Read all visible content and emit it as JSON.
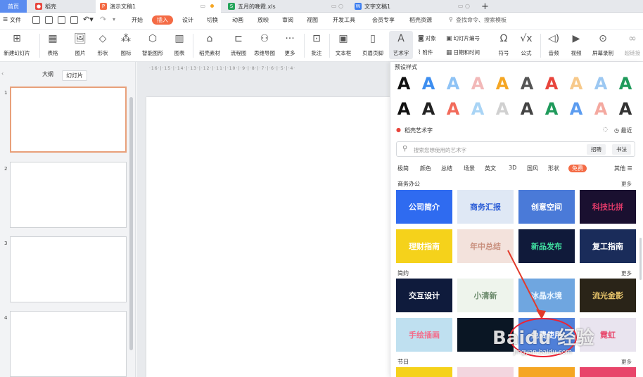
{
  "tabs": [
    {
      "label": "首页",
      "color": "#5b8cf0"
    },
    {
      "label": "稻壳",
      "color": "#e8453c"
    },
    {
      "label": "演示文稿1",
      "color": "#f46b45"
    },
    {
      "label": "五月的晚霞.xls",
      "color": "#25a55b"
    },
    {
      "label": "文字文稿1",
      "color": "#3b7df0"
    }
  ],
  "tab_plus": "+",
  "menu": {
    "file": "文件",
    "items": [
      "开始",
      "插入",
      "设计",
      "切换",
      "动画",
      "放映",
      "审阅",
      "视图",
      "开发工具",
      "会员专享",
      "稻壳资源"
    ],
    "active": "插入",
    "search": "查找命令、搜索模板"
  },
  "ribbon": {
    "new_slide": "新建幻灯片",
    "table": "表格",
    "picture": "图片",
    "shape": "形状",
    "icon": "图标",
    "smartart": "智能图形",
    "chart": "图表",
    "docer_material": "稻壳素材",
    "flowchart": "流程图",
    "mindmap": "思维导图",
    "more": "更多",
    "comment": "批注",
    "textbox": "文本框",
    "header_footer": "页眉页脚",
    "wordart": "艺术字",
    "object": "对象",
    "attachment": "附件",
    "slide_number": "幻灯片编号",
    "datetime": "日期和时间",
    "symbol": "符号",
    "formula": "公式",
    "audio": "音频",
    "video": "视频",
    "screen_record": "屏幕录制",
    "hyperlink": "超链接"
  },
  "left_panel": {
    "tabs": [
      "大纲",
      "幻灯片"
    ],
    "active_tab": "幻灯片",
    "slides": [
      "1",
      "2",
      "3",
      "4"
    ]
  },
  "ruler_text": "·16·|·15·|·14·|·13·|·12·|·11·|·10·|·9·|·8·|·7·|·6·|·5·|·4·",
  "art_panel": {
    "preset_title": "预设样式",
    "presets_row1": [
      {
        "ch": "A",
        "color": "#111111"
      },
      {
        "ch": "A",
        "color": "#3d8ef0"
      },
      {
        "ch": "A",
        "color": "#8fc3f5"
      },
      {
        "ch": "A",
        "color": "#f2b8b8"
      },
      {
        "ch": "A",
        "color": "#f5a623"
      },
      {
        "ch": "A",
        "color": "#555555"
      },
      {
        "ch": "A",
        "color": "#e8453c"
      },
      {
        "ch": "A",
        "color": "#f7c98a"
      },
      {
        "ch": "A",
        "color": "#9cc8f2"
      },
      {
        "ch": "A",
        "color": "#1f9a5b"
      }
    ],
    "presets_row2": [
      {
        "ch": "A",
        "color": "#111111"
      },
      {
        "ch": "A",
        "color": "#222222"
      },
      {
        "ch": "A",
        "color": "#f26b5b"
      },
      {
        "ch": "A",
        "color": "#a9d4f5"
      },
      {
        "ch": "A",
        "color": "#d0d0d0"
      },
      {
        "ch": "A",
        "color": "#444444"
      },
      {
        "ch": "A",
        "color": "#1f9a5b"
      },
      {
        "ch": "A",
        "color": "#5b9cf0"
      },
      {
        "ch": "A",
        "color": "#f4a9a0"
      },
      {
        "ch": "A",
        "color": "#333333"
      }
    ],
    "docer_title": "稻壳艺术字",
    "recent": "最近",
    "search_placeholder": "搜索您想使用的艺术字",
    "btn_recruit": "招聘",
    "btn_calligraphy": "书法",
    "categories": [
      "极简",
      "颜色",
      "总结",
      "场景",
      "英文",
      "3D",
      "国风",
      "形状",
      "免费"
    ],
    "active_category": "免费",
    "other": "其他",
    "more": "更多",
    "sections": [
      {
        "title": "商务办公",
        "cards": [
          {
            "text": "公司简介",
            "bg": "#2f6bf0",
            "fg": "#ffffff"
          },
          {
            "text": "商务汇报",
            "bg": "#dfe8f5",
            "fg": "#2a5cd6"
          },
          {
            "text": "创意空间",
            "bg": "#4a7ad8",
            "fg": "#ffffff"
          },
          {
            "text": "科技比拼",
            "bg": "#1a1030",
            "fg": "#e23a6a"
          },
          {
            "text": "理财指南",
            "bg": "#f5d21b",
            "fg": "#ffffff"
          },
          {
            "text": "年中总结",
            "bg": "#f3e2dc",
            "fg": "#c9907e"
          },
          {
            "text": "新品发布",
            "bg": "#101a3a",
            "fg": "#40e0a0"
          },
          {
            "text": "复工指南",
            "bg": "#1a2c5a",
            "fg": "#ffffff"
          }
        ]
      },
      {
        "title": "简约",
        "cards": [
          {
            "text": "交互设计",
            "bg": "#0f1b3c",
            "fg": "#ffffff"
          },
          {
            "text": "小清新",
            "bg": "#eef4ec",
            "fg": "#6b8a6b"
          },
          {
            "text": "冰晶水境",
            "bg": "#6fa6e0",
            "fg": "#e8f4ff"
          },
          {
            "text": "流光金影",
            "bg": "#2a2418",
            "fg": "#e6c36a"
          },
          {
            "text": "手绘插画",
            "bg": "#bfe0f0",
            "fg": "#f46b8a"
          },
          {
            "text": "",
            "bg": "#0a1624",
            "fg": "#ffffff"
          },
          {
            "text": "免费使用",
            "bg": "#4f7fd8",
            "fg": "#ffffff"
          },
          {
            "text": "霓虹",
            "bg": "#e9e4ef",
            "fg": "#e8456a"
          }
        ]
      }
    ],
    "festival_title": "节日"
  },
  "watermark": {
    "text": "Baidu 经验",
    "sub": "jingyan.baidu.com"
  }
}
